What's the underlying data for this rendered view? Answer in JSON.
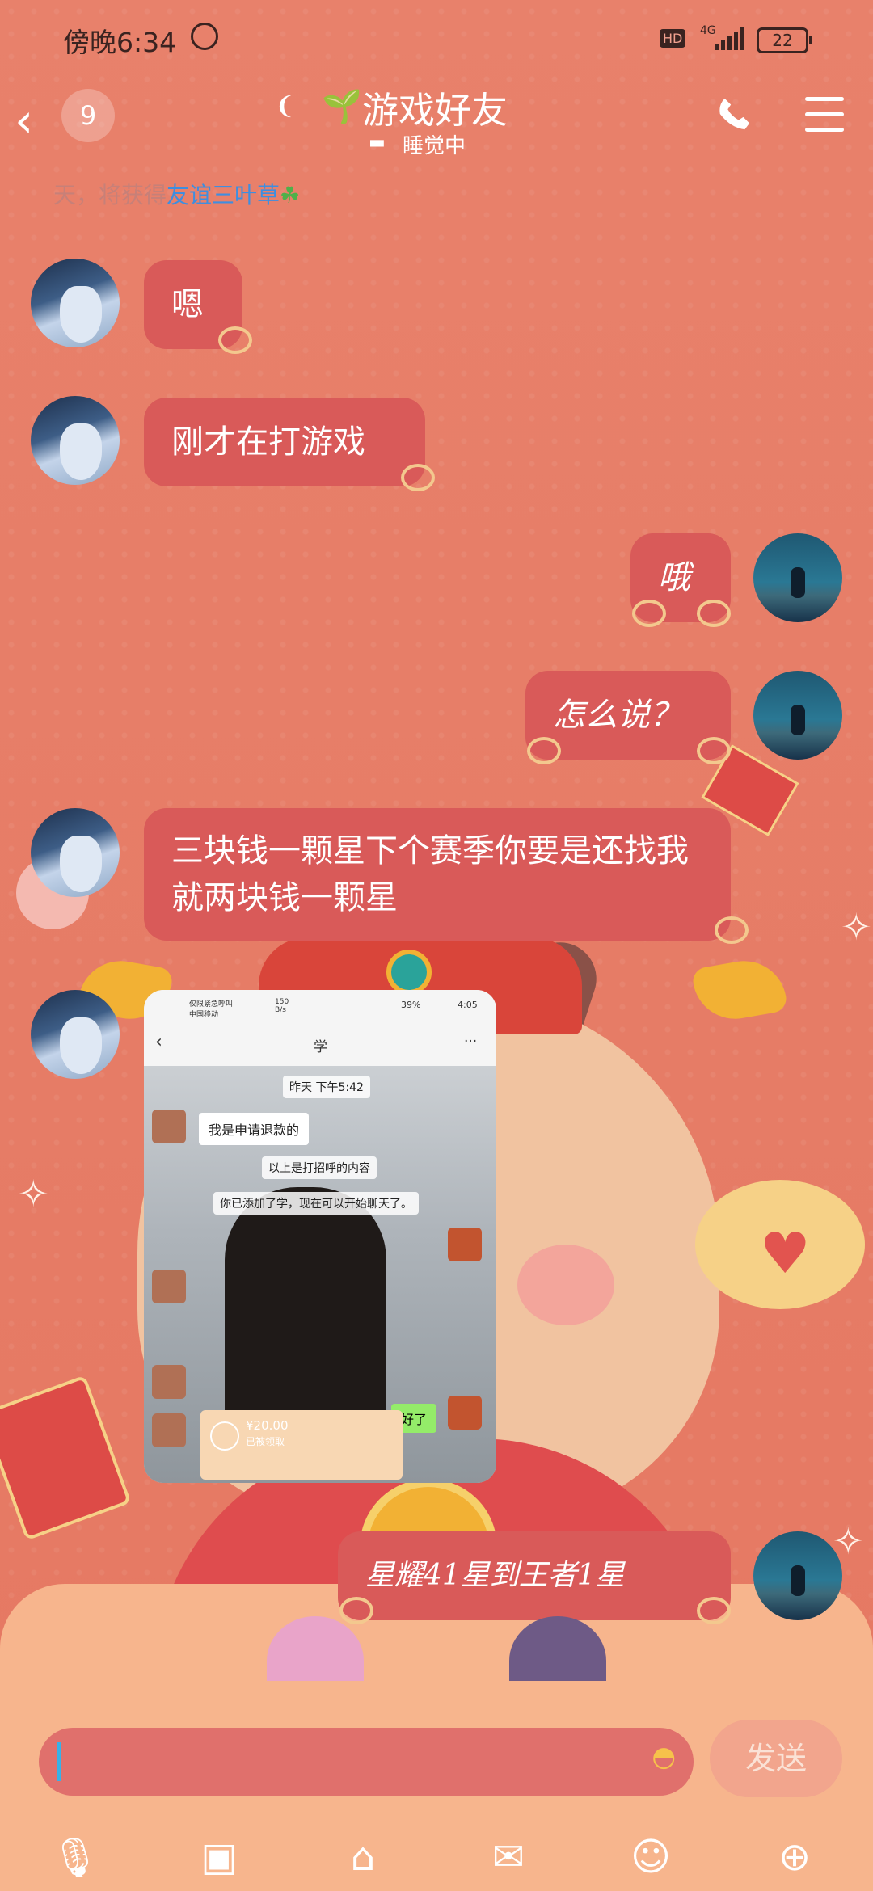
{
  "status_bar": {
    "time": "傍晚6:34",
    "hd": "HD",
    "network": "4G",
    "battery": "22"
  },
  "header": {
    "back_label": "<",
    "unread_count": "9",
    "title": "游戏好友",
    "status": "睡觉中"
  },
  "system_notice": {
    "prefix": "天，将获得",
    "highlight": "友谊三叶草",
    "icon": "☘"
  },
  "messages": [
    {
      "side": "left",
      "text": "嗯"
    },
    {
      "side": "left",
      "text": "刚才在打游戏"
    },
    {
      "side": "right",
      "text": "哦"
    },
    {
      "side": "right",
      "text": "怎么说？"
    },
    {
      "side": "left",
      "text": "三块钱一颗星下个赛季你要是还找我就两块钱一颗星"
    },
    {
      "side": "right",
      "text": "星耀41星到王者1星"
    }
  ],
  "screenshot_msg": {
    "carrier": "仅限紧急呼叫\n中国移动",
    "speed": "150\nB/s",
    "battery": "39%",
    "time": "4:05",
    "chat_title": "学",
    "more": "···",
    "ts": "昨天 下午5:42",
    "msg1": "我是申请退款的",
    "sys1": "以上是打招呼的内容",
    "sys2": "你已添加了学，现在可以开始聊天了。",
    "reply": "好了",
    "pay_amount": "¥20.00",
    "pay_status": "已被领取"
  },
  "input": {
    "send_label": "发送"
  },
  "toolbar": [
    "mic",
    "image",
    "camera",
    "red-packet",
    "emoji",
    "plus"
  ]
}
